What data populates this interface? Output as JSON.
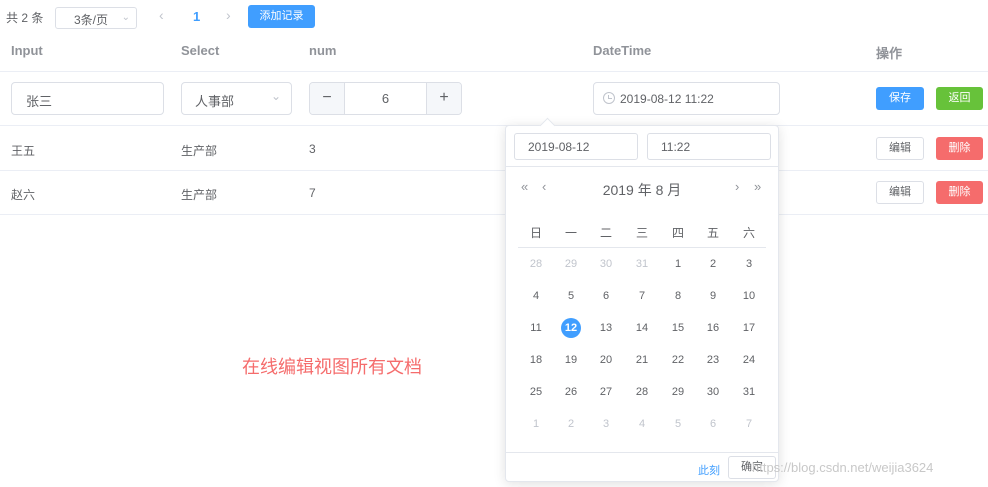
{
  "pagination": {
    "total": "共 2 条",
    "page_size": "3条/页",
    "page": "1"
  },
  "toolbar": {
    "add_label": "添加记录"
  },
  "table": {
    "headers": [
      "Input",
      "Select",
      "num",
      "DateTime",
      "操作"
    ],
    "edit_row": {
      "input_value": "张三",
      "select_value": "人事部",
      "num_value": "6",
      "datetime_value": "2019-08-12 11:22",
      "save_label": "保存",
      "back_label": "返回"
    },
    "rows": [
      {
        "name": "王五",
        "dept": "生产部",
        "num": "3",
        "edit_label": "编辑",
        "delete_label": "删除"
      },
      {
        "name": "赵六",
        "dept": "生产部",
        "num": "7",
        "edit_label": "编辑",
        "delete_label": "删除"
      }
    ]
  },
  "overlay_text": "在线编辑视图所有文档",
  "watermark": "https://blog.csdn.net/weijia3624",
  "picker": {
    "date_value": "2019-08-12",
    "time_value": "11:22",
    "title": "2019 年  8 月",
    "weekdays": [
      "日",
      "一",
      "二",
      "三",
      "四",
      "五",
      "六"
    ],
    "days": [
      [
        "28",
        "29",
        "30",
        "31",
        "1",
        "2",
        "3"
      ],
      [
        "4",
        "5",
        "6",
        "7",
        "8",
        "9",
        "10"
      ],
      [
        "11",
        "12",
        "13",
        "14",
        "15",
        "16",
        "17"
      ],
      [
        "18",
        "19",
        "20",
        "21",
        "22",
        "23",
        "24"
      ],
      [
        "25",
        "26",
        "27",
        "28",
        "29",
        "30",
        "31"
      ],
      [
        "1",
        "2",
        "3",
        "4",
        "5",
        "6",
        "7"
      ]
    ],
    "selected_day": "12",
    "now_label": "此刻",
    "ok_label": "确定",
    "nav": {
      "prev_year": "«",
      "prev_month": "‹",
      "next_month": "›",
      "next_year": "»"
    }
  },
  "colors": {
    "primary": "#409eff",
    "success": "#67c23a",
    "danger": "#f56c6c"
  }
}
